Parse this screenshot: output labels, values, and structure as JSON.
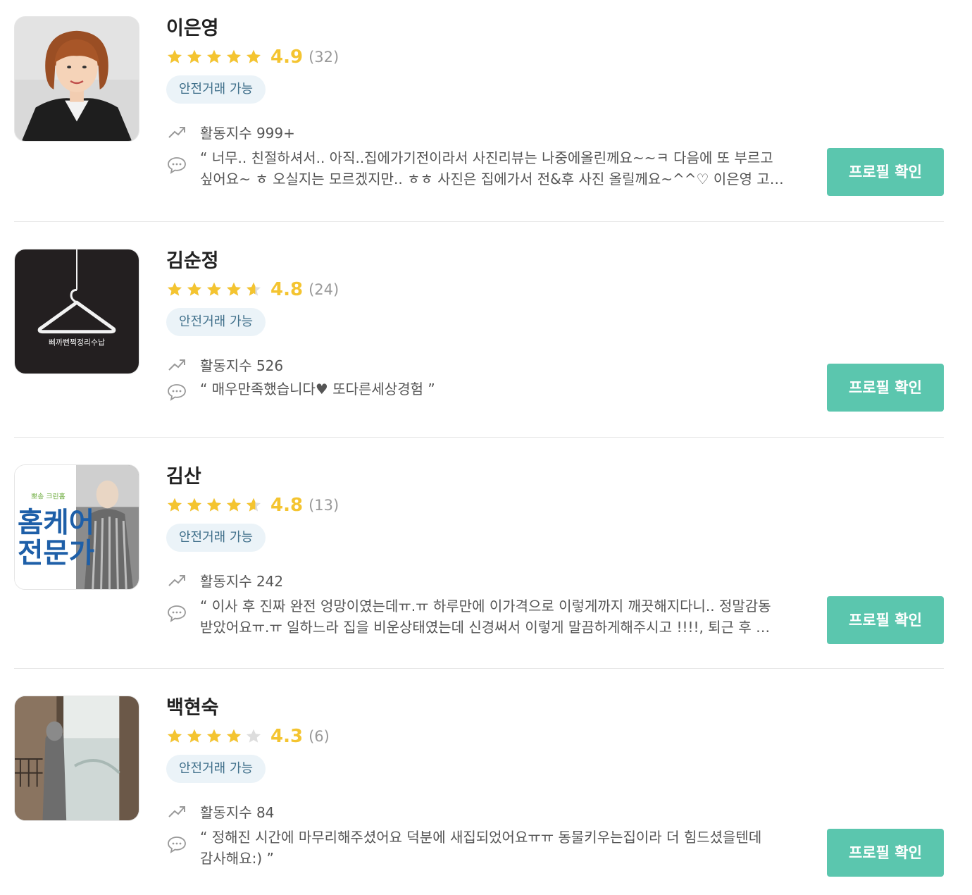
{
  "colors": {
    "star_filled": "#f4c430",
    "star_empty": "#dddddd",
    "score": "#f4c430",
    "button_bg": "#5bc6ae",
    "badge_bg": "#ebf3f8",
    "badge_text": "#3f6f8a"
  },
  "icons": {
    "activity": "trending-up-icon",
    "review": "chat-bubble-icon",
    "rating": "star-icon"
  },
  "pros": [
    {
      "name": "이은영",
      "rating": 4.9,
      "score_label": "4.9",
      "count_label": "(32)",
      "badge": "안전거래 가능",
      "activity_label": "활동지수 999+",
      "review": "“ 너무.. 친절하셔서.. 아직..집에가기전이라서 사진리뷰는 나중에올린께요~~ㅋ 다음에 또 부르고 싶어요~ ㅎ 오실지는 모르겠지만.. ㅎㅎ 사진은 집에가서 전&후 사진 올릴께요~^^♡ 이은영 고…",
      "button_label": "프로필 확인",
      "avatar": "profile-photo"
    },
    {
      "name": "김순정",
      "rating": 4.6,
      "score_label": "4.8",
      "count_label": "(24)",
      "badge": "안전거래 가능",
      "activity_label": "활동지수 526",
      "review": "“ 매우만족했습니다♥ 또다른세상경험 ”",
      "button_label": "프로필 확인",
      "avatar": "hanger-logo",
      "avatar_text": "삐까뻔쩍정리수납"
    },
    {
      "name": "김산",
      "rating": 4.6,
      "score_label": "4.8",
      "count_label": "(13)",
      "badge": "안전거래 가능",
      "activity_label": "활동지수 242",
      "review": "“ 이사 후 진짜 완전 엉망이였는데ㅠ.ㅠ 하루만에 이가격으로 이렇게까지 깨끗해지다니.. 정말감동 받았어요ㅠ.ㅠ 일하느라 집을 비운상태였는데 신경써서 이렇게 말끔하게해주시고 !!!!, 퇴근 후 …",
      "button_label": "프로필 확인",
      "avatar": "homecare-banner",
      "avatar_small_text": "뽀송 크린홈",
      "avatar_line1": "홈케어",
      "avatar_line2": "전문가"
    },
    {
      "name": "백현숙",
      "rating": 4.0,
      "score_label": "4.3",
      "count_label": "(6)",
      "badge": "안전거래 가능",
      "activity_label": "활동지수 84",
      "review": "“ 정해진 시간에 마무리해주셨어요 덕분에 새집되었어요ㅠㅠ 동물키우는집이라 더 힘드셨을텐데 감사해요:) ”",
      "button_label": "프로필 확인",
      "avatar": "window-photo"
    }
  ]
}
